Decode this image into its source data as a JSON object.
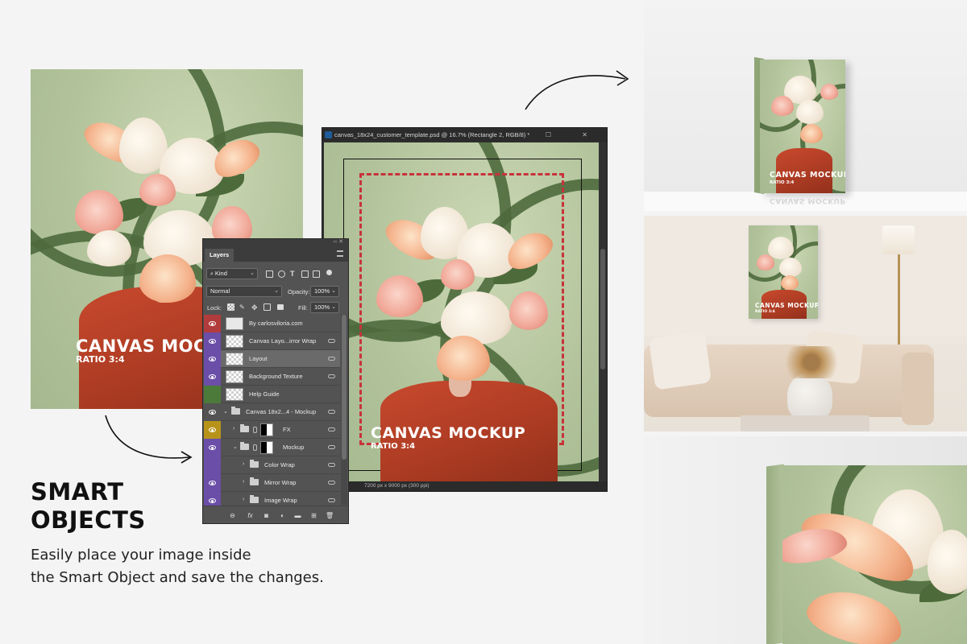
{
  "headline": {
    "line1": "SMART",
    "line2": "OBJECTS"
  },
  "description": {
    "line1": "Easily place your image inside",
    "line2": "the Smart Object and save the changes."
  },
  "artwork": {
    "title": "CANVAS MOCKUP",
    "subtitle": "RATIO 3:4",
    "cropped_title": "CANVAS MOCK",
    "mirrored_title": "CANVAS MOCKUP",
    "mirrored_sub": "RATIO 3:4"
  },
  "document": {
    "title": "canvas_18x24_customer_template.psd @ 16.7% (Rectangle 2, RGB/8) *",
    "status": "7200 px x 9000 px (300 ppi)",
    "window_buttons": "– ☐ ✕"
  },
  "layers_panel": {
    "tab": "Layers",
    "filter_kind": "Kind",
    "blend_mode": "Normal",
    "opacity_label": "Opacity:",
    "opacity_value": "100%",
    "lock_label": "Lock:",
    "fill_label": "Fill:",
    "fill_value": "100%",
    "top_controls": "‹‹ ✕",
    "layers": [
      {
        "name": "By carlosviloria.com",
        "color": "#b23b3b"
      },
      {
        "name": "Canvas Layo...irror Wrap",
        "color": "#6b4ea8"
      },
      {
        "name": "Layout",
        "color": "#6b4ea8"
      },
      {
        "name": "Background Texture",
        "color": "#6b4ea8"
      },
      {
        "name": "Help Guide",
        "color": "#4c7a3a"
      },
      {
        "name": "Canvas 18x2...4 - Mockup",
        "color": "#535353"
      },
      {
        "name": "FX",
        "color": "#b8931a"
      },
      {
        "name": "Mockup",
        "color": "#6b4ea8"
      },
      {
        "name": "Color Wrap",
        "color": "#6b4ea8"
      },
      {
        "name": "Mirror Wrap",
        "color": "#6b4ea8"
      },
      {
        "name": "Image Wrap",
        "color": "#6b4ea8"
      }
    ]
  },
  "colors": {
    "sage": "#b9c8a4",
    "swirl": "#4e6a3c",
    "robe": "#b03f25",
    "guide": "#c8323a"
  },
  "icons": [
    "arrow-curve-top-icon",
    "arrow-curve-bottom-icon",
    "eye-icon",
    "folder-icon",
    "link-icon",
    "trash-icon",
    "new-layer-icon"
  ]
}
